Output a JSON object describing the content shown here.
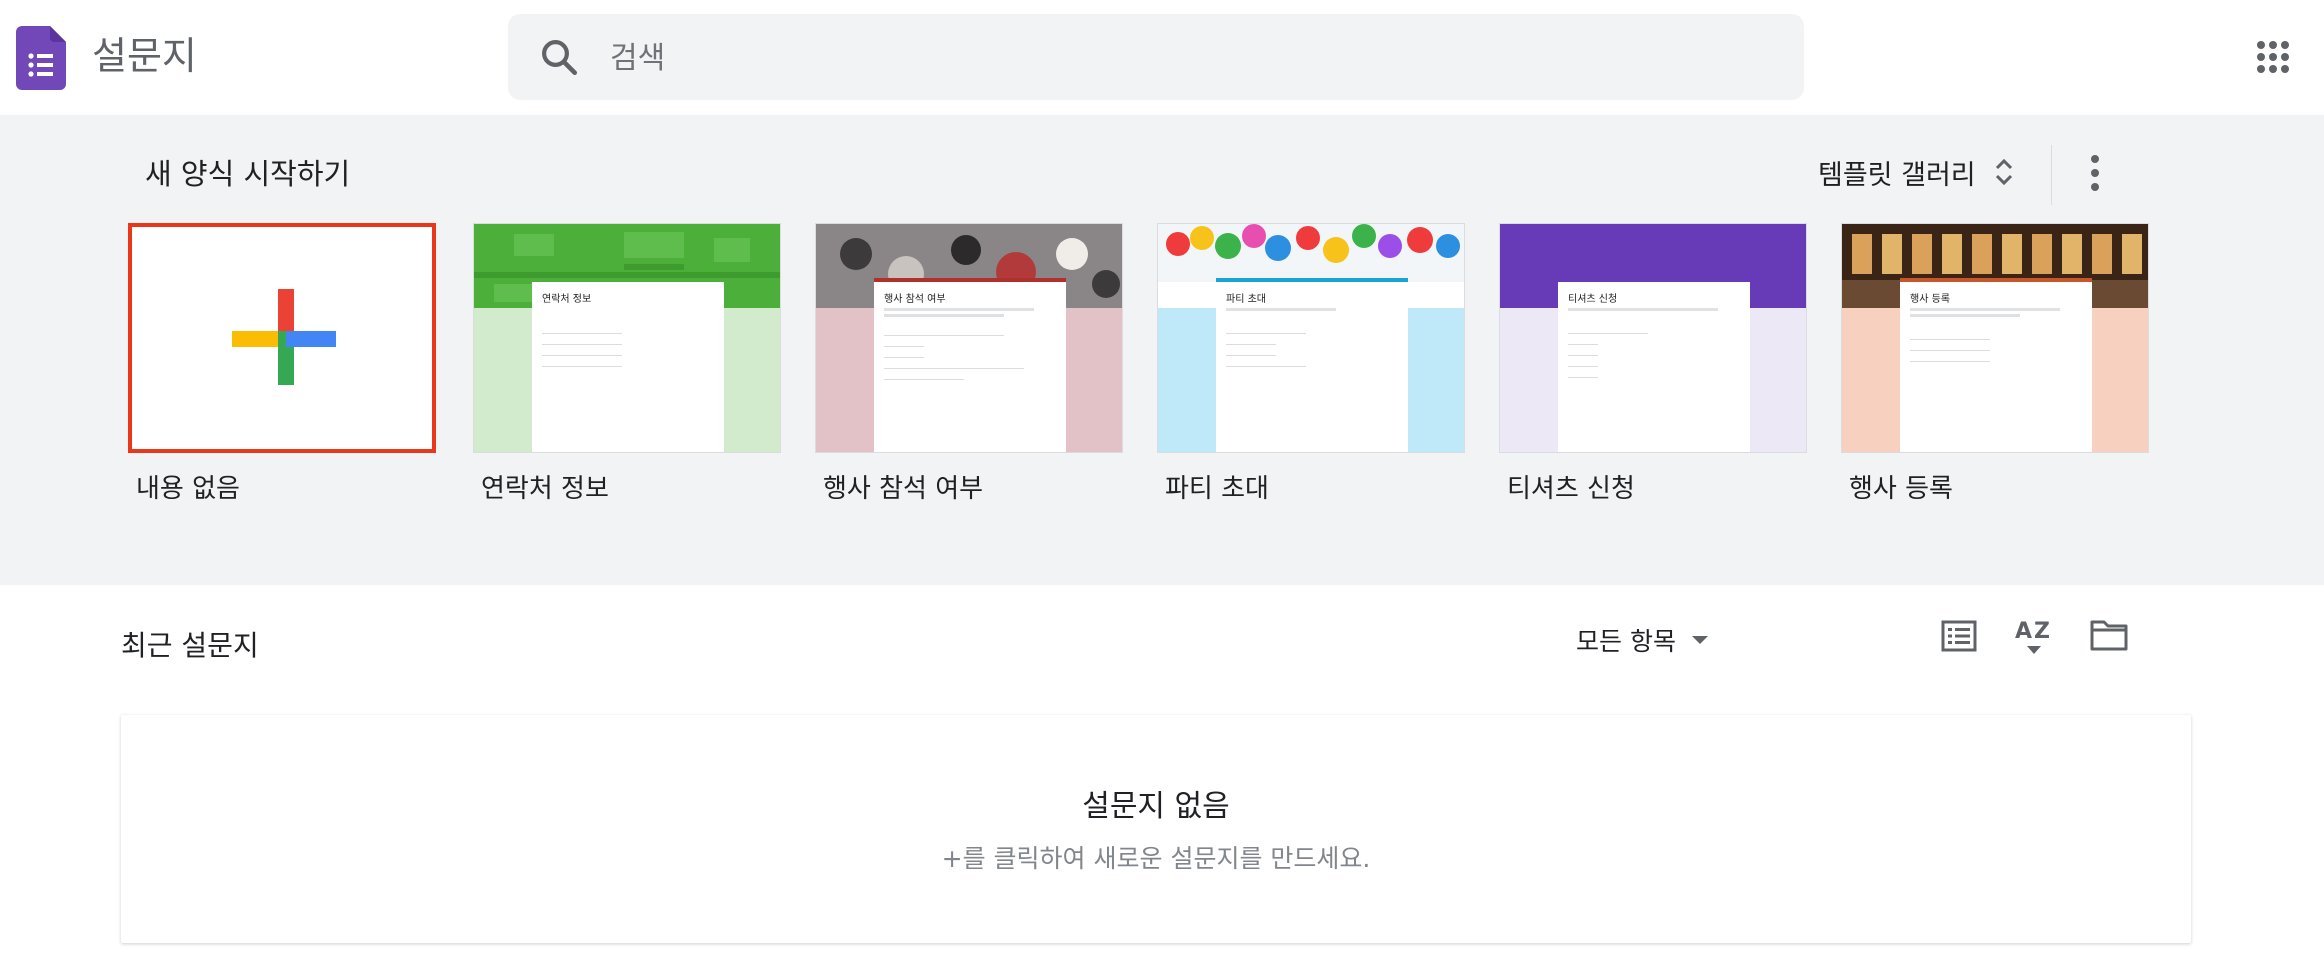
{
  "header": {
    "app_title": "설문지",
    "search_placeholder": "검색",
    "icons": {
      "logo": "forms-logo-icon",
      "search": "search-icon",
      "apps": "apps-grid-icon"
    }
  },
  "templates": {
    "title": "새 양식 시작하기",
    "gallery_label": "템플릿 갤러리",
    "items": [
      {
        "label": "내용 없음"
      },
      {
        "label": "연락처 정보",
        "form_title": "연락처 정보",
        "accent": "#4caf3a",
        "band": "#d3ebcd"
      },
      {
        "label": "행사 참석 여부",
        "form_title": "행사 참석 여부",
        "accent": "#b0302c",
        "band": "#e3c2c7"
      },
      {
        "label": "파티 초대",
        "form_title": "파티 초대",
        "accent": "#1aa3d9",
        "band": "#bfe8f8"
      },
      {
        "label": "티셔츠 신청",
        "form_title": "티셔츠 신청",
        "accent": "#673ab7",
        "band": "#ece8f5"
      },
      {
        "label": "행사 등록",
        "form_title": "행사 등록",
        "accent": "#c9562b",
        "band": "#f8d0bf"
      }
    ]
  },
  "recent": {
    "title": "최근 설문지",
    "filter_label": "모든 항목",
    "empty_title": "설문지 없음",
    "empty_subtitle": "+를 클릭하여 새로운 설문지를 만드세요."
  },
  "colors": {
    "band_bg": "#f1f3f4",
    "selected_border": "#e8371b",
    "forms_purple": "#7248b9"
  }
}
